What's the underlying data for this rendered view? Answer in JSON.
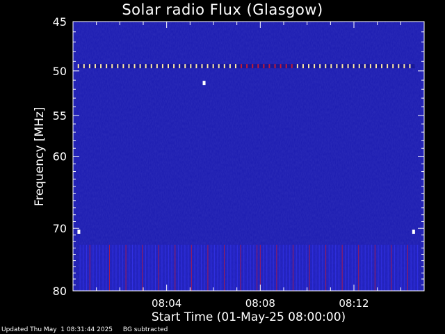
{
  "chart_data": {
    "type": "heatmap",
    "title": "Solar radio Flux (Glasgow)",
    "xlabel": "Start Time (01-May-25 08:00:00)",
    "ylabel": "Frequency [MHz]",
    "x_ticks": [
      "08:04",
      "08:08",
      "08:12"
    ],
    "x_tick_minutes": [
      4,
      8,
      12
    ],
    "xlim_minutes": [
      0,
      15
    ],
    "y_ticks": [
      45,
      50,
      55,
      60,
      70,
      80
    ],
    "ylim": [
      45,
      80
    ],
    "y_scale": "log",
    "features": [
      {
        "type": "dashed-band",
        "freq": 49.5,
        "x_from": 0.2,
        "x_to": 14.6
      },
      {
        "type": "dot",
        "freq": 51.3,
        "x": 5.6
      },
      {
        "type": "dot",
        "freq": 70.5,
        "x": 0.25
      },
      {
        "type": "dot",
        "freq": 70.5,
        "x": 14.55
      },
      {
        "type": "vertical-striations",
        "freq_from": 72.5,
        "freq_to": 80,
        "x_from": 0.3,
        "x_to": 14.8
      }
    ],
    "colors": {
      "background": "#1b1bb0",
      "dark": "#0c0c7c",
      "accent": "#c21a3a",
      "highlight": "#ffe9a8"
    }
  },
  "footer": {
    "updated": "Updated Thu May  1 08:31:44 2025",
    "note": "BG subtracted"
  }
}
